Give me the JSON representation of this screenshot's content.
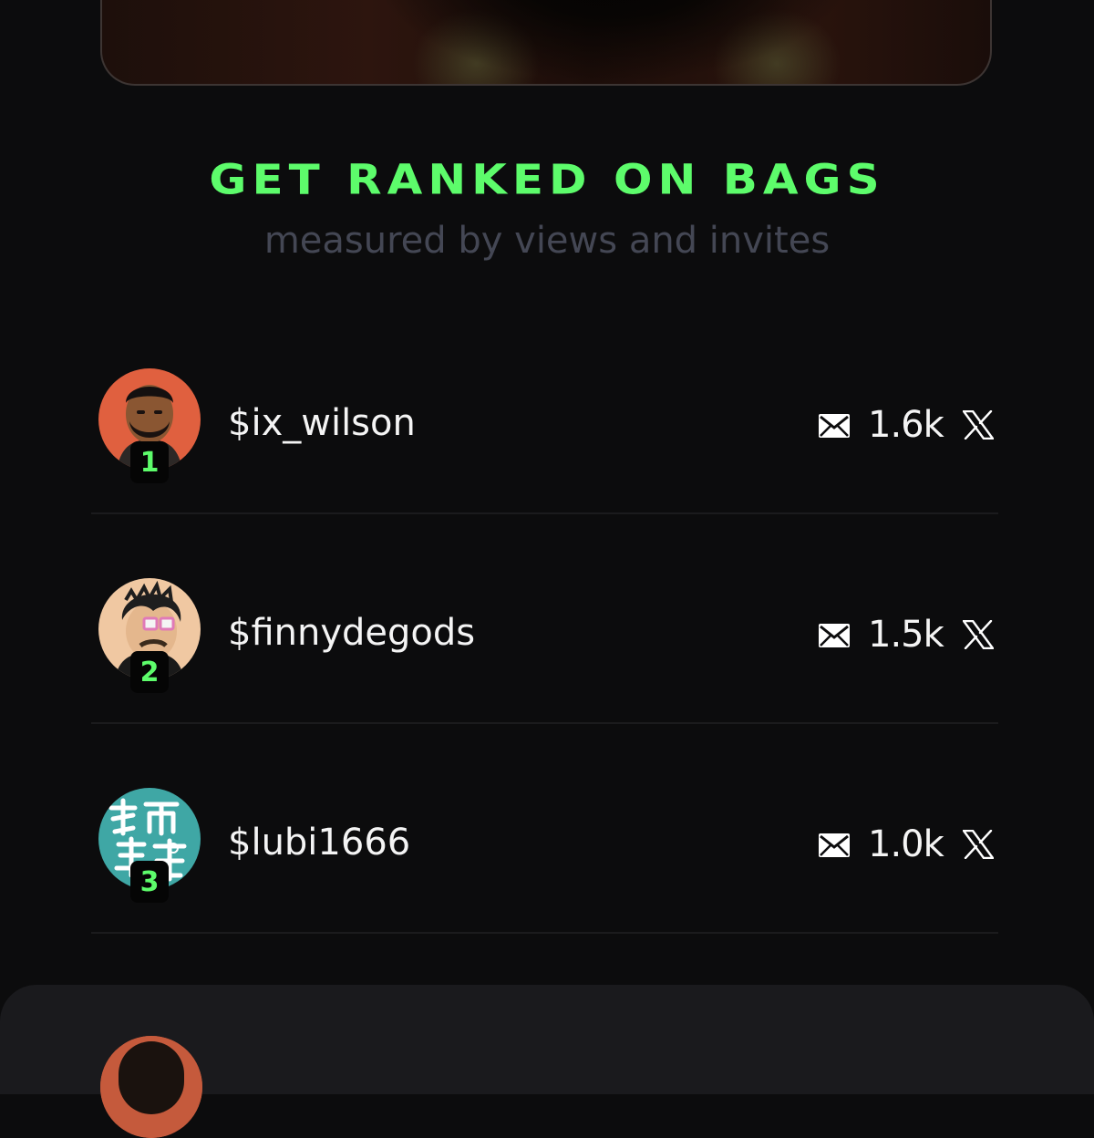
{
  "header": {
    "title": "GET RANKED ON BAGS",
    "subtitle": "measured by views and invites"
  },
  "leaderboard": [
    {
      "rank": "1",
      "username": "$ix_wilson",
      "invites": "1.6k",
      "avatar_icon": "portrait-avatar-icon"
    },
    {
      "rank": "2",
      "username": "$finnydegods",
      "invites": "1.5k",
      "avatar_icon": "cartoon-avatar-icon"
    },
    {
      "rank": "3",
      "username": "$lubi1666",
      "invites": "1.0k",
      "avatar_icon": "teal-logo-avatar-icon"
    }
  ],
  "icons": {
    "invites": "mail-icon",
    "social": "x-logo-icon"
  },
  "colors": {
    "background": "#0c0c0d",
    "accent": "#5dfc6b",
    "subtitle": "#444754",
    "panel": "#1a1a1d"
  }
}
